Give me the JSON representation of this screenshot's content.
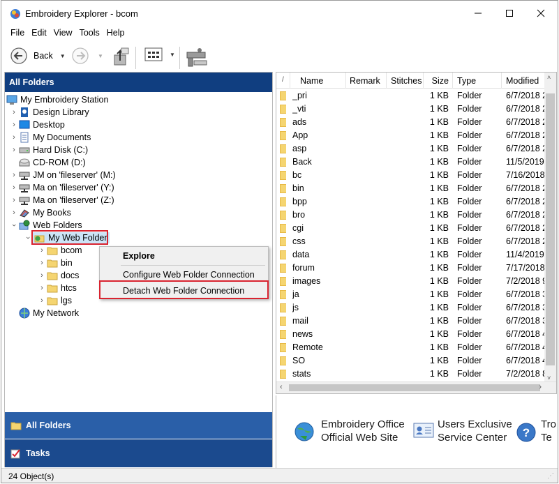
{
  "window": {
    "title": "Embroidery Explorer - bcom"
  },
  "menu": [
    "File",
    "Edit",
    "View",
    "Tools",
    "Help"
  ],
  "toolbar": {
    "back_label": "Back"
  },
  "left_pane": {
    "header": "All Folders",
    "tree": [
      {
        "label": "My Embroidery Station",
        "icon": "monitor-icon"
      },
      {
        "label": "Design Library",
        "icon": "design-library-icon"
      },
      {
        "label": "Desktop",
        "icon": "desktop-icon"
      },
      {
        "label": "My Documents",
        "icon": "documents-icon"
      },
      {
        "label": "Hard Disk (C:)",
        "icon": "hard-disk-icon"
      },
      {
        "label": "CD-ROM (D:)",
        "icon": "cd-rom-icon"
      },
      {
        "label": "JM on 'fileserver' (M:)",
        "icon": "network-drive-icon"
      },
      {
        "label": "Ma on 'fileserver' (Y:)",
        "icon": "network-drive-icon"
      },
      {
        "label": "Ma on 'fileserver' (Z:)",
        "icon": "network-drive-icon"
      },
      {
        "label": "My Books",
        "icon": "books-icon"
      },
      {
        "label": "Web Folders",
        "icon": "web-folders-icon"
      },
      {
        "label": "My Web Folder",
        "icon": "web-folder-icon"
      },
      {
        "label": "bcom",
        "icon": "folder-icon"
      },
      {
        "label": "bin",
        "icon": "folder-icon"
      },
      {
        "label": "docs",
        "icon": "folder-icon"
      },
      {
        "label": "htcs",
        "icon": "folder-icon"
      },
      {
        "label": "lgs",
        "icon": "folder-icon"
      },
      {
        "label": "My Network",
        "icon": "network-icon"
      }
    ],
    "nav_all_folders": "All Folders",
    "nav_tasks": "Tasks"
  },
  "context_menu": {
    "explore": "Explore",
    "configure": "Configure Web Folder Connection",
    "detach": "Detach Web Folder Connection"
  },
  "list": {
    "columns": [
      "Name",
      "Remark",
      "Stitches",
      "Size",
      "Type",
      "Modified"
    ],
    "rows": [
      {
        "name": "_pri",
        "size": "1 KB",
        "type": "Folder",
        "modified": "6/7/2018 2"
      },
      {
        "name": "_vti",
        "size": "1 KB",
        "type": "Folder",
        "modified": "6/7/2018 2"
      },
      {
        "name": "ads",
        "size": "1 KB",
        "type": "Folder",
        "modified": "6/7/2018 2"
      },
      {
        "name": "App",
        "size": "1 KB",
        "type": "Folder",
        "modified": "6/7/2018 2"
      },
      {
        "name": "asp",
        "size": "1 KB",
        "type": "Folder",
        "modified": "6/7/2018 2"
      },
      {
        "name": "Back",
        "size": "1 KB",
        "type": "Folder",
        "modified": "11/5/2019"
      },
      {
        "name": "bc",
        "size": "1 KB",
        "type": "Folder",
        "modified": "7/16/2018"
      },
      {
        "name": "bin",
        "size": "1 KB",
        "type": "Folder",
        "modified": "6/7/2018 2"
      },
      {
        "name": "bpp",
        "size": "1 KB",
        "type": "Folder",
        "modified": "6/7/2018 2"
      },
      {
        "name": "bro",
        "size": "1 KB",
        "type": "Folder",
        "modified": "6/7/2018 2"
      },
      {
        "name": "cgi",
        "size": "1 KB",
        "type": "Folder",
        "modified": "6/7/2018 2"
      },
      {
        "name": "css",
        "size": "1 KB",
        "type": "Folder",
        "modified": "6/7/2018 2"
      },
      {
        "name": "data",
        "size": "1 KB",
        "type": "Folder",
        "modified": "11/4/2019"
      },
      {
        "name": "forum",
        "size": "1 KB",
        "type": "Folder",
        "modified": "7/17/2018"
      },
      {
        "name": "images",
        "size": "1 KB",
        "type": "Folder",
        "modified": "7/2/2018 9"
      },
      {
        "name": "ja",
        "size": "1 KB",
        "type": "Folder",
        "modified": "6/7/2018 3"
      },
      {
        "name": "js",
        "size": "1 KB",
        "type": "Folder",
        "modified": "6/7/2018 3"
      },
      {
        "name": "mail",
        "size": "1 KB",
        "type": "Folder",
        "modified": "6/7/2018 3"
      },
      {
        "name": "news",
        "size": "1 KB",
        "type": "Folder",
        "modified": "6/7/2018 4"
      },
      {
        "name": "Remote",
        "size": "1 KB",
        "type": "Folder",
        "modified": "6/7/2018 4"
      },
      {
        "name": "SO",
        "size": "1 KB",
        "type": "Folder",
        "modified": "6/7/2018 4"
      },
      {
        "name": "stats",
        "size": "1 KB",
        "type": "Folder",
        "modified": "7/2/2018 8"
      }
    ]
  },
  "links": [
    {
      "line1": "Embroidery Office",
      "line2": "Official Web Site",
      "icon": "globe-icon"
    },
    {
      "line1": "Users Exclusive",
      "line2": "Service Center",
      "icon": "contact-card-icon"
    },
    {
      "line1": "Tro",
      "line2": "Te",
      "icon": "help-icon"
    }
  ],
  "status": {
    "text": "24 Object(s)"
  }
}
